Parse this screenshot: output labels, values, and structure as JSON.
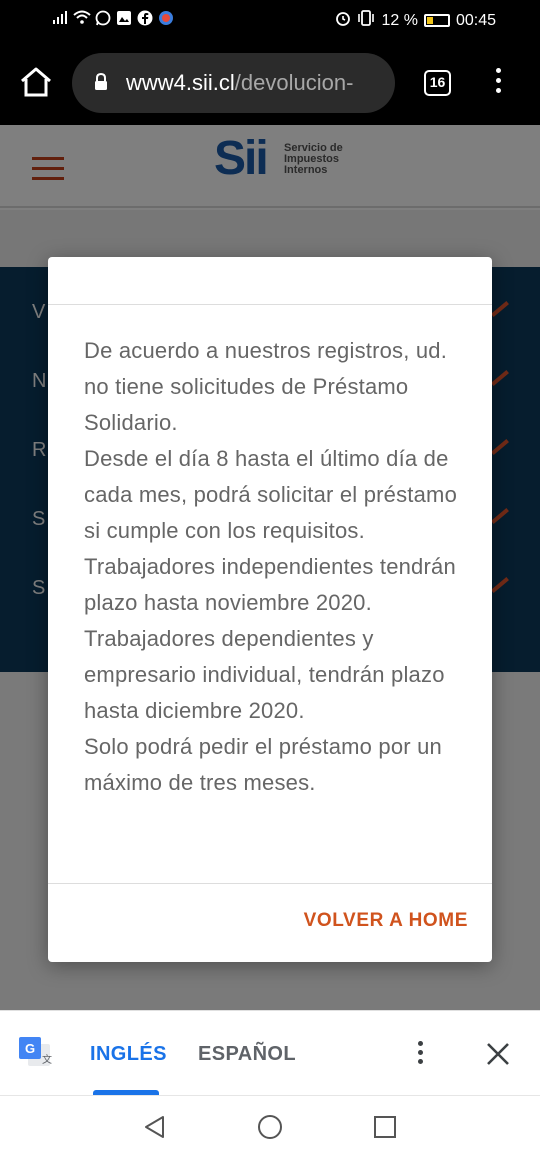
{
  "status_bar": {
    "battery_percent": "12 %",
    "time": "00:45"
  },
  "browser": {
    "url_host": "www4.sii.cl",
    "url_path": "/devolucion-",
    "tab_count": "16"
  },
  "site": {
    "logo_mark": "Sii",
    "logo_text_line1": "Servicio de",
    "logo_text_line2": "Impuestos",
    "logo_text_line3": "Internos",
    "menu_letters": [
      "V",
      "N",
      "R",
      "S",
      "S"
    ]
  },
  "dialog": {
    "paragraph_1": "De acuerdo a nuestros registros, ud. no tiene solicitudes de Préstamo Solidario.",
    "paragraph_2": "Desde el día 8 hasta el último día de cada mes, podrá solicitar el préstamo si cumple con los requisitos.",
    "paragraph_3": "Trabajadores independientes tendrán plazo hasta noviembre 2020. Trabajadores dependientes y empresario individual, tendrán plazo hasta diciembre 2020.",
    "paragraph_4": "Solo podrá pedir el préstamo por un máximo de tres meses.",
    "button_label": "VOLVER A HOME"
  },
  "translate_bar": {
    "lang_selected": "INGLÉS",
    "lang_other": "ESPAÑOL"
  },
  "colors": {
    "accent_orange": "#d0531d",
    "google_blue": "#1a73e8",
    "sii_navy": "#0c3a5c"
  }
}
